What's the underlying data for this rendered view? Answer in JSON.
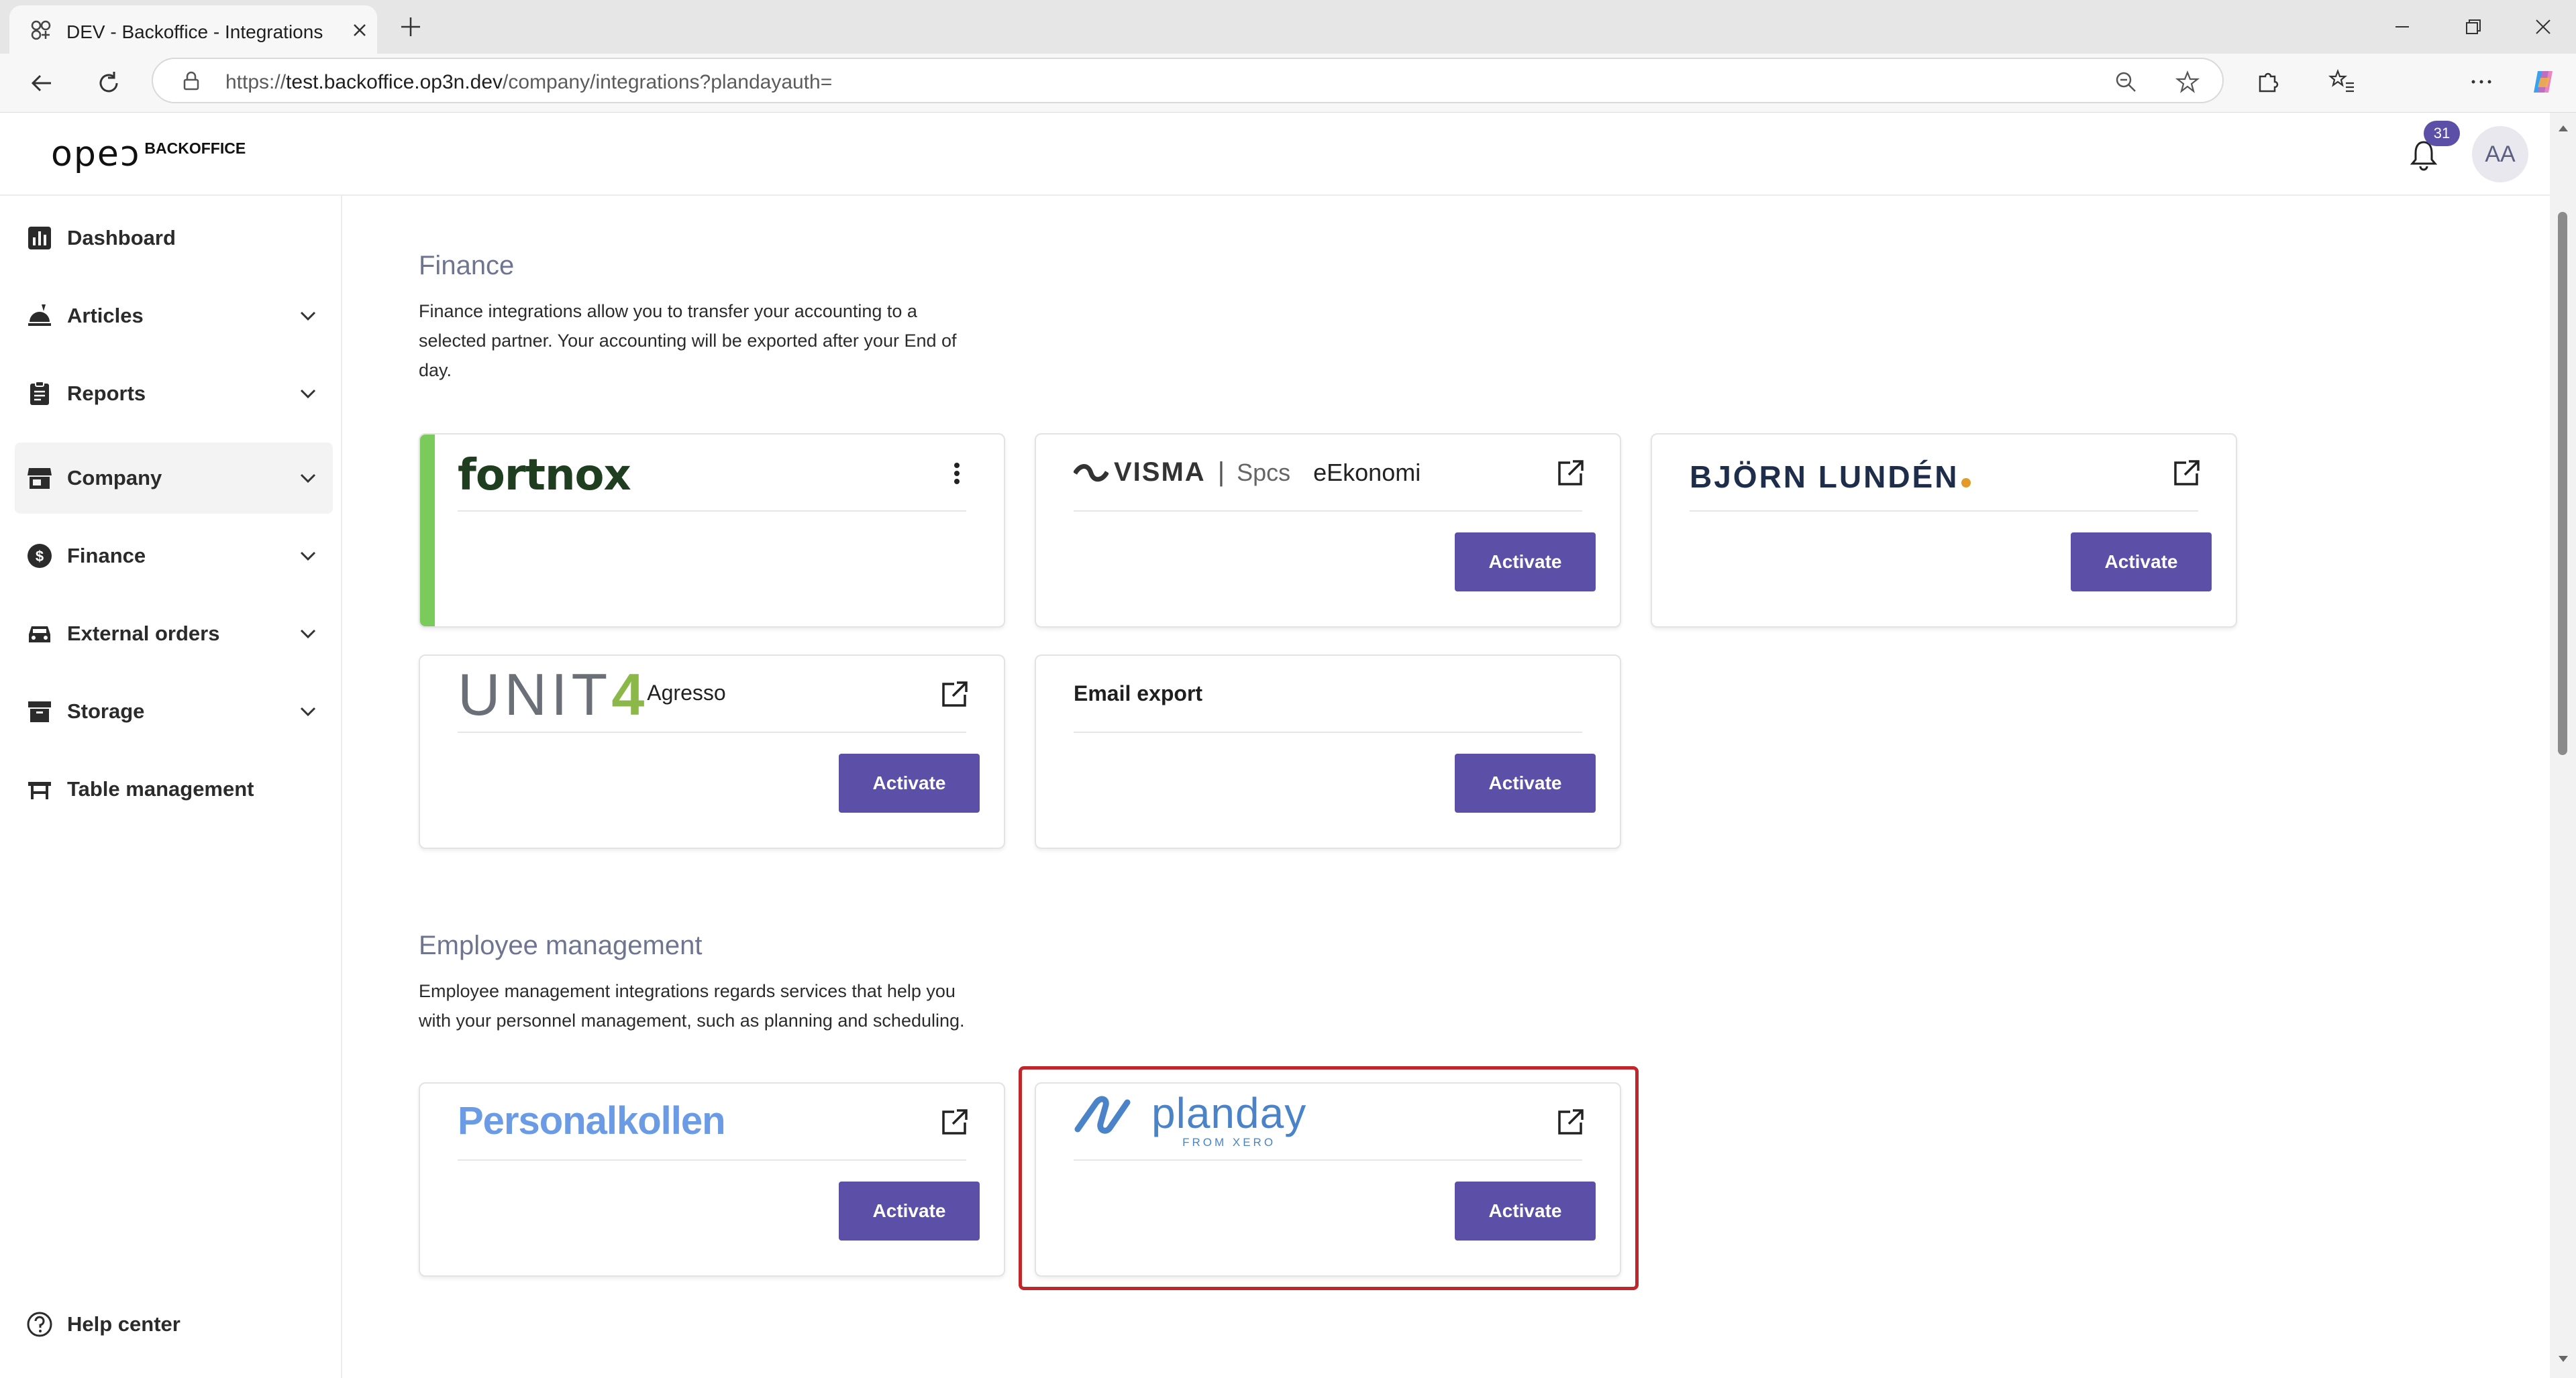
{
  "browser": {
    "tab_title": "DEV - Backoffice - Integrations",
    "url_prefix": "https://",
    "url_host": "test.backoffice.op3n.dev",
    "url_path": "/company/integrations?plandayauth="
  },
  "app": {
    "logo_text": "opeɔ",
    "logo_sub": "BACKOFFICE",
    "notification_count": "31",
    "avatar_initials": "AA"
  },
  "sidebar": {
    "items": [
      {
        "label": "Dashboard",
        "icon": "bar-chart-icon",
        "has_chevron": false
      },
      {
        "label": "Articles",
        "icon": "food-tray-icon",
        "has_chevron": true
      },
      {
        "label": "Reports",
        "icon": "clipboard-icon",
        "has_chevron": true
      },
      {
        "label": "Company",
        "icon": "store-icon",
        "has_chevron": true,
        "active": true
      },
      {
        "label": "Finance",
        "icon": "dollar-icon",
        "has_chevron": true
      },
      {
        "label": "External orders",
        "icon": "car-icon",
        "has_chevron": true
      },
      {
        "label": "Storage",
        "icon": "archive-box-icon",
        "has_chevron": true
      },
      {
        "label": "Table management",
        "icon": "table-icon",
        "has_chevron": false
      }
    ],
    "help_label": "Help center"
  },
  "finance": {
    "title": "Finance",
    "description_line1": "Finance integrations allow you to transfer your accounting to a",
    "description_line2": "selected partner. Your accounting will be exported after your End of",
    "description_line3": "day.",
    "cards": {
      "fortnox": {
        "brand": "fortnox",
        "action": "more-vertical-icon"
      },
      "visma": {
        "brand_main": "VISMA",
        "brand_sep": "|",
        "brand_spcs": "Spcs",
        "brand_product": "eEkonomi",
        "button": "Activate"
      },
      "bjorn": {
        "brand": "BJÖRN LUNDÉN",
        "button": "Activate"
      },
      "unit4": {
        "brand_main": "UNIT",
        "brand_four": "4",
        "brand_product": "Agresso",
        "button": "Activate"
      },
      "email": {
        "title": "Email export",
        "button": "Activate"
      }
    }
  },
  "employee": {
    "title": "Employee management",
    "description_line1": "Employee management integrations regards services that help you",
    "description_line2": "with your personnel management, such as planning and scheduling.",
    "cards": {
      "personalkollen": {
        "brand": "Personalkollen",
        "button": "Activate"
      },
      "planday": {
        "brand": "planday",
        "brand_sub": "FROM XERO",
        "button": "Activate"
      }
    }
  },
  "colors": {
    "accent": "#5b4fa8",
    "fortnox_green": "#7acb5b",
    "highlight_red": "#c1262a",
    "section_title": "#6f7490"
  }
}
